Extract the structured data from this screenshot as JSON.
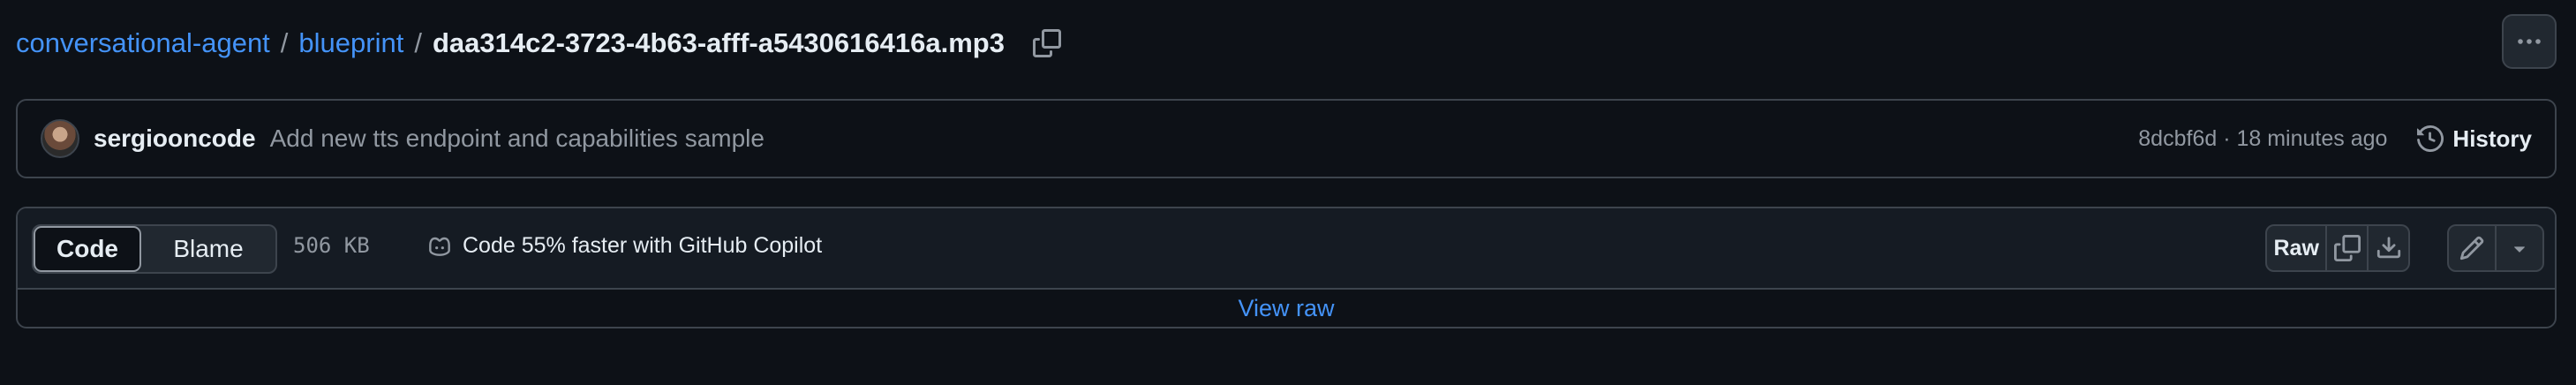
{
  "breadcrumb": {
    "repo": "conversational-agent",
    "folder": "blueprint",
    "separator": "/",
    "file": "daa314c2-3723-4b63-afff-a5430616416a.mp3"
  },
  "commit": {
    "author": "sergiooncode",
    "message": "Add new tts endpoint and capabilities sample",
    "meta": "8dcbf6d · 18 minutes ago",
    "history_label": "History"
  },
  "file_header": {
    "tabs": [
      "Code",
      "Blame"
    ],
    "active_tab": "Code",
    "size": "506 KB",
    "copilot_text": "Code 55% faster with GitHub Copilot",
    "raw_label": "Raw"
  },
  "body": {
    "view_raw": "View raw"
  },
  "colors": {
    "background": "#0d1117",
    "link": "#4493f8",
    "border": "#3d444d",
    "muted": "#9198a1"
  },
  "icons": [
    "copy-icon",
    "kebab-icon",
    "history-icon",
    "copilot-icon",
    "download-icon",
    "pencil-icon",
    "triangle-down-icon"
  ]
}
